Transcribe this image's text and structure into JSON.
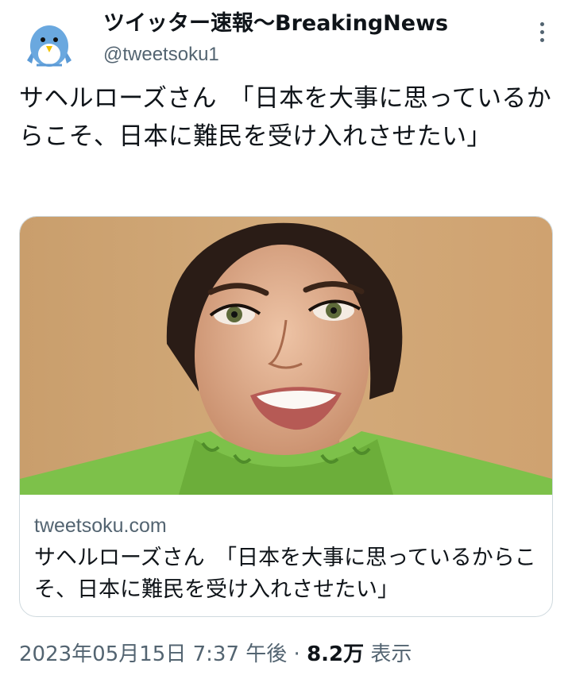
{
  "account": {
    "display_name": "ツイッター速報〜BreakingNews",
    "handle": "@tweetsoku1",
    "avatar_icon": "bird-avatar-icon"
  },
  "more_icon": "more-options-icon",
  "tweet": {
    "text": "サヘルローズさん　「日本を大事に思っているからこそ、日本に難民を受け入れさせたい」"
  },
  "card": {
    "domain": "tweetsoku.com",
    "title": "サヘルローズさん　「日本を大事に思っているからこそ、日本に難民を受け入れさせたい」"
  },
  "meta": {
    "timestamp": "2023年05月15日 7:37 午後",
    "separator": " · ",
    "views_count": "8.2万",
    "views_label": "表示"
  },
  "colors": {
    "text": "#0f1419",
    "secondary": "#536471",
    "border": "#cfd9de",
    "avatar_blue": "#6aa8df"
  }
}
